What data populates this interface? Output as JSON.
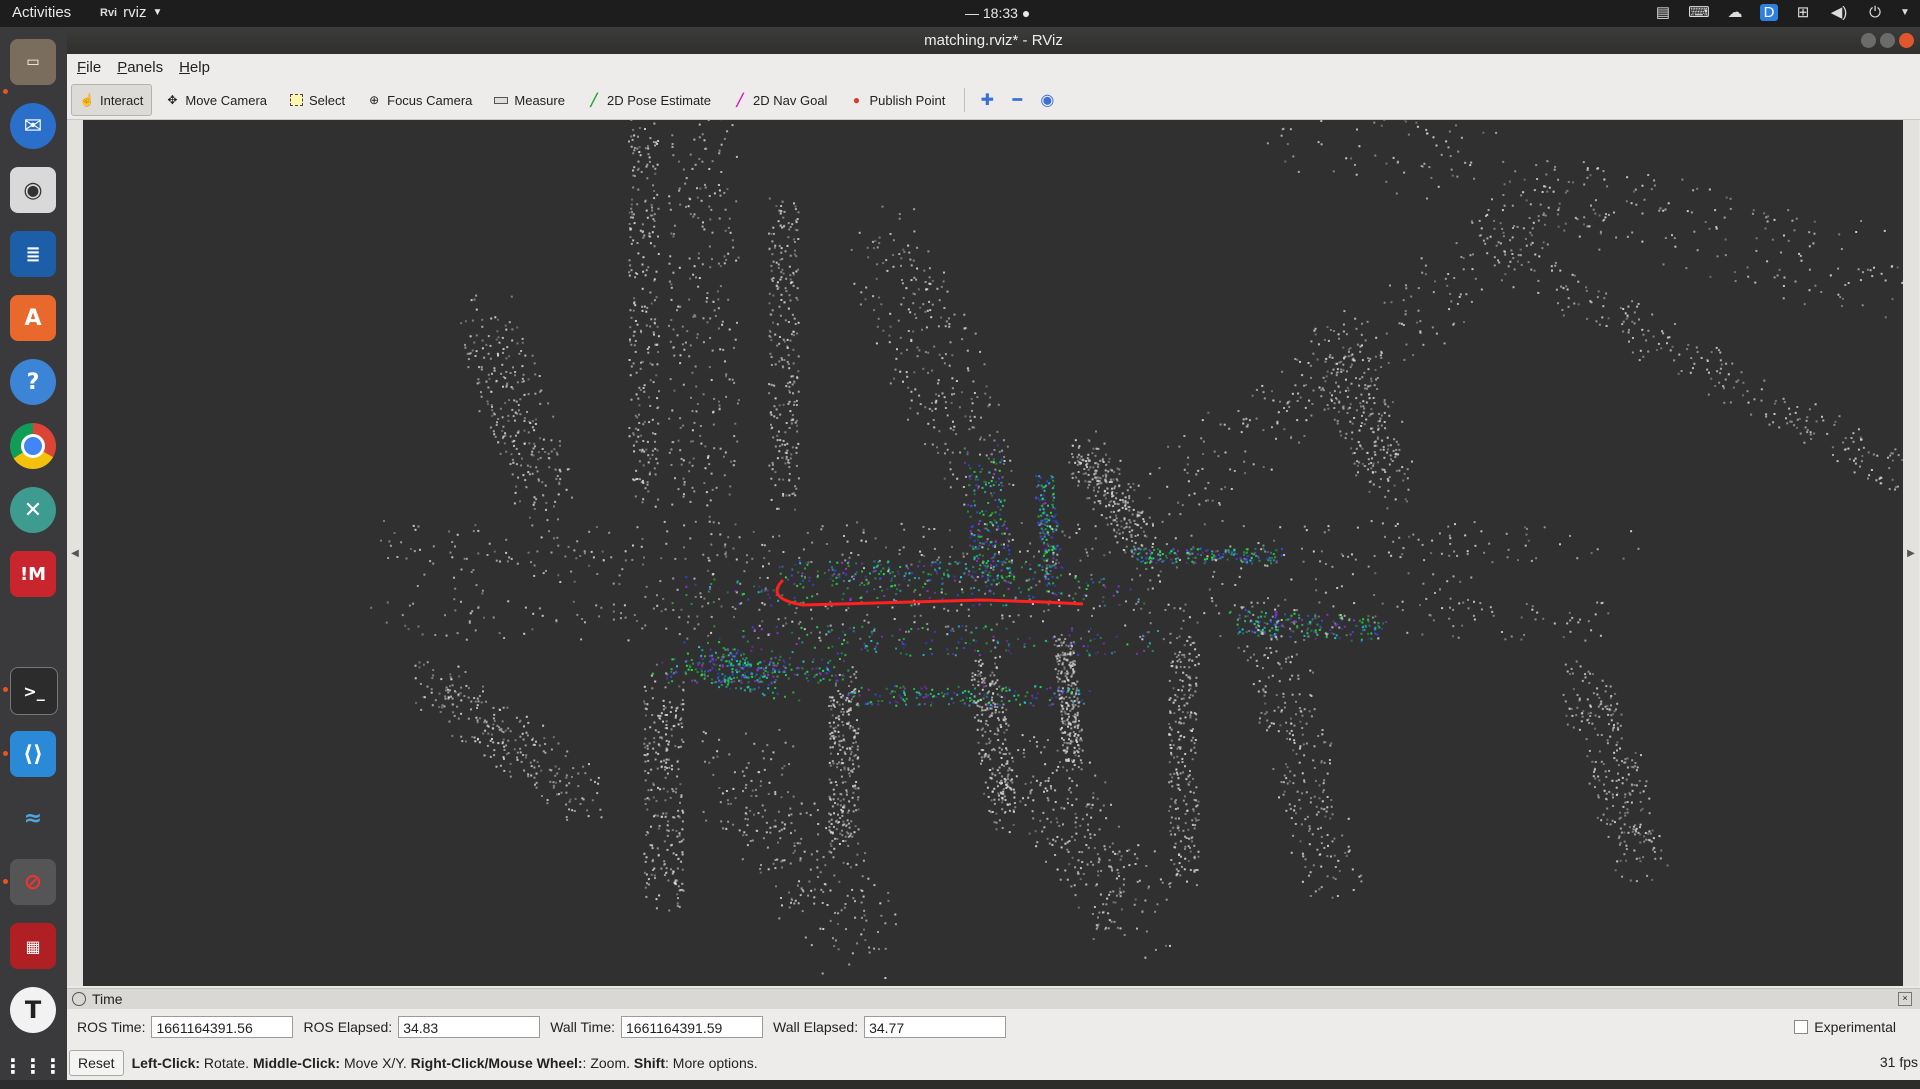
{
  "topbar": {
    "activities": "Activities",
    "app_name": "rviz",
    "app_icon_text": "Rvi",
    "clock": "— 18:33 ●",
    "tray_icons": [
      "keyboard-icon",
      "keyboard-layout-icon",
      "cloud-icon",
      "dropbox-icon",
      "network-icon",
      "volume-icon",
      "power-icon"
    ]
  },
  "dock": {
    "items": [
      "files",
      "thunderbird",
      "rhythmbox",
      "writer",
      "software-center",
      "help",
      "chrome",
      "remmina",
      "mendeley",
      "terminal",
      "vscode",
      "kali",
      "screen-recorder",
      "ros-tools",
      "typora",
      "show-apps"
    ]
  },
  "window": {
    "title": "matching.rviz* - RViz"
  },
  "menu": {
    "file": "File",
    "panels": "Panels",
    "help": "Help"
  },
  "toolbar": {
    "interact": "Interact",
    "move_camera": "Move Camera",
    "select": "Select",
    "focus_camera": "Focus Camera",
    "measure": "Measure",
    "pose_estimate": "2D Pose Estimate",
    "nav_goal": "2D Nav Goal",
    "publish_point": "Publish Point"
  },
  "time_panel": {
    "title": "Time",
    "ros_time_label": "ROS Time:",
    "ros_time_value": "1661164391.56",
    "ros_elapsed_label": "ROS Elapsed:",
    "ros_elapsed_value": "34.83",
    "wall_time_label": "Wall Time:",
    "wall_time_value": "1661164391.59",
    "wall_elapsed_label": "Wall Elapsed:",
    "wall_elapsed_value": "34.77",
    "experimental_label": "Experimental",
    "experimental_checked": false
  },
  "status": {
    "reset_label": "Reset",
    "hint_1_b": "Left-Click:",
    "hint_1": " Rotate. ",
    "hint_2_b": "Middle-Click:",
    "hint_2": " Move X/Y. ",
    "hint_3_b": "Right-Click/Mouse Wheel:",
    "hint_3": ": Zoom. ",
    "hint_4_b": "Shift",
    "hint_4": ": More options.",
    "fps": "31 fps"
  },
  "colors": {
    "viewport_bg": "#303030",
    "map_points": "#d6d6d6",
    "scan_green": "#22e84a",
    "scan_cyan": "#1fd0e0",
    "scan_blue": "#2e4cff",
    "scan_purple": "#a02cf0",
    "trajectory": "#ff2020"
  }
}
